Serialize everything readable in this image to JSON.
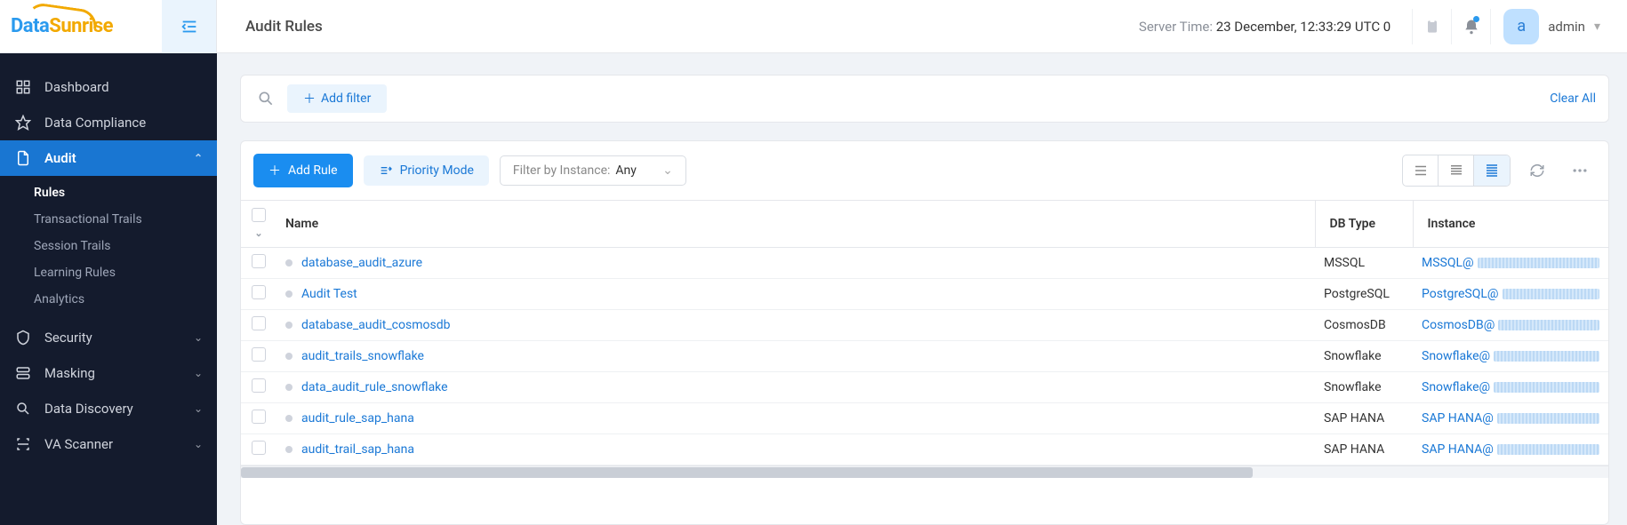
{
  "brand": {
    "part1": "Data",
    "part2": "Sunrise"
  },
  "page_title": "Audit Rules",
  "server_time": {
    "label": "Server Time:",
    "value": "23 December, 12:33:29  UTC 0"
  },
  "user": {
    "avatar_initial": "a",
    "name": "admin"
  },
  "sidebar": {
    "items": [
      {
        "label": "Dashboard",
        "icon": "grid"
      },
      {
        "label": "Data Compliance",
        "icon": "star"
      },
      {
        "label": "Audit",
        "icon": "file",
        "active": true,
        "expanded": true,
        "children": [
          {
            "label": "Rules",
            "active": true
          },
          {
            "label": "Transactional Trails"
          },
          {
            "label": "Session Trails"
          },
          {
            "label": "Learning Rules"
          },
          {
            "label": "Analytics"
          }
        ]
      },
      {
        "label": "Security",
        "icon": "shield",
        "chev": true
      },
      {
        "label": "Masking",
        "icon": "db2",
        "chev": true
      },
      {
        "label": "Data Discovery",
        "icon": "search",
        "chev": true
      },
      {
        "label": "VA Scanner",
        "icon": "scan",
        "chev": true
      }
    ]
  },
  "filters": {
    "add_label": "Add filter",
    "clear_label": "Clear All"
  },
  "toolbar": {
    "add_rule": "Add Rule",
    "priority_mode": "Priority Mode",
    "instance_filter_label": "Filter by Instance:",
    "instance_filter_value": "Any"
  },
  "table": {
    "headers": {
      "name": "Name",
      "db_type": "DB Type",
      "instance": "Instance"
    },
    "rows": [
      {
        "name": "database_audit_azure",
        "db_type": "MSSQL",
        "instance_prefix": "MSSQL@"
      },
      {
        "name": "Audit Test",
        "db_type": "PostgreSQL",
        "instance_prefix": "PostgreSQL@"
      },
      {
        "name": "database_audit_cosmosdb",
        "db_type": "CosmosDB",
        "instance_prefix": "CosmosDB@"
      },
      {
        "name": "audit_trails_snowflake",
        "db_type": "Snowflake",
        "instance_prefix": "Snowflake@"
      },
      {
        "name": "data_audit_rule_snowflake",
        "db_type": "Snowflake",
        "instance_prefix": "Snowflake@"
      },
      {
        "name": "audit_rule_sap_hana",
        "db_type": "SAP HANA",
        "instance_prefix": "SAP HANA@"
      },
      {
        "name": "audit_trail_sap_hana",
        "db_type": "SAP HANA",
        "instance_prefix": "SAP HANA@"
      }
    ]
  }
}
